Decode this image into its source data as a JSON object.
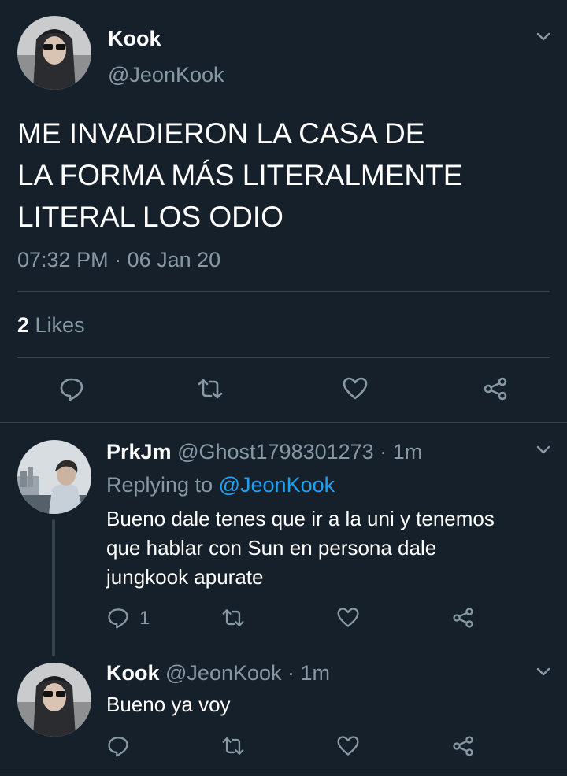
{
  "main_tweet": {
    "display_name": "Kook",
    "handle": "@JeonKook",
    "text_lines": [
      "ME INVADIERON LA CASA DE",
      "LA FORMA MÁS LITERALMENTE",
      "LITERAL LOS ODIO"
    ],
    "timestamp": "07:32 PM · 06 Jan 20",
    "likes_count": "2",
    "likes_label": "Likes"
  },
  "reply1": {
    "display_name": "PrkJm",
    "handle": "@Ghost1798301273",
    "time": "· 1m",
    "replying_prefix": "Replying to",
    "replying_handle": "@JeonKook",
    "text_lines": [
      "Bueno dale tenes que ir a la uni y tenemos",
      "que hablar con Sun en persona dale",
      "jungkook apurate"
    ],
    "reply_count": "1"
  },
  "reply2": {
    "display_name": "Kook",
    "handle": "@JeonKook",
    "time": "· 1m",
    "text": "Bueno ya voy"
  },
  "colors": {
    "background": "#15202b",
    "text": "#ffffff",
    "muted": "#8899a6",
    "link": "#1da1f2",
    "divider": "#38444d"
  },
  "icons": [
    "chevron-down-icon",
    "reply-icon",
    "retweet-icon",
    "like-icon",
    "share-icon"
  ]
}
